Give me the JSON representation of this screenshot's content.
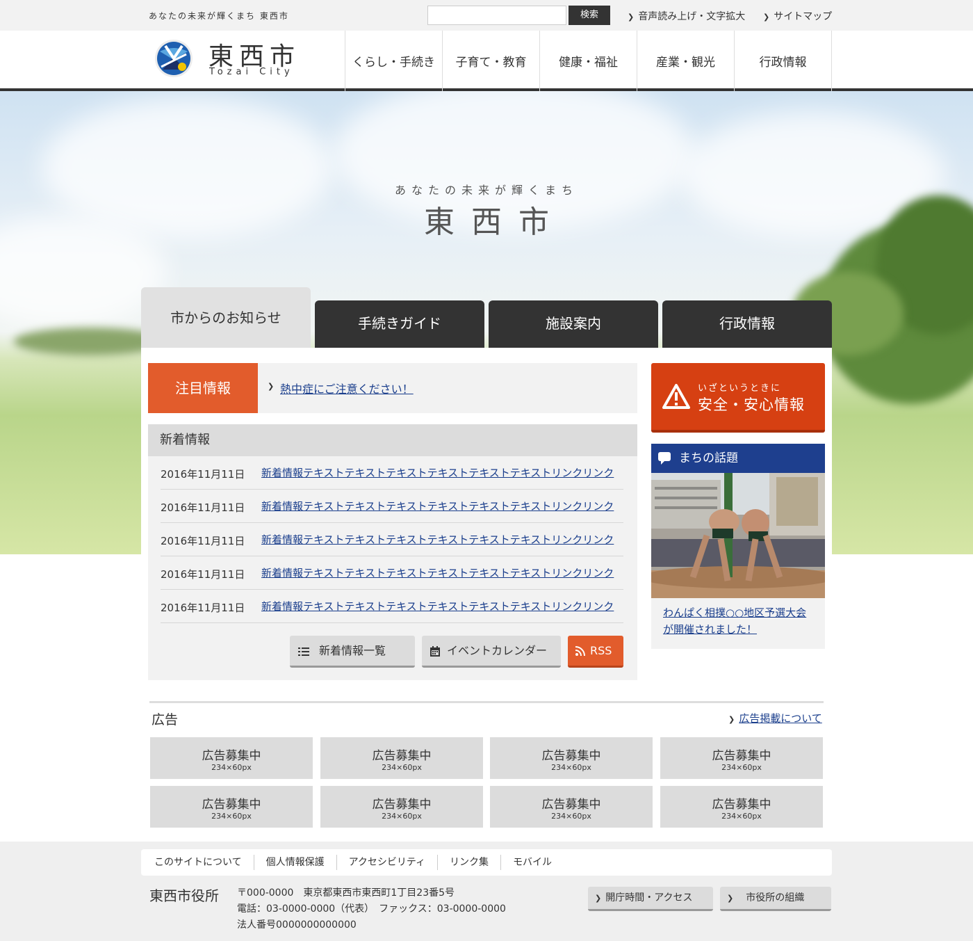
{
  "topbar": {
    "tagline": "あなたの未来が輝くまち 東西市",
    "search_placeholder": "",
    "search_button": "検索",
    "voice_link": "音声読み上げ・文字拡大",
    "sitemap_link": "サイトマップ"
  },
  "header": {
    "title": "東西市",
    "subtitle": "Tozai City",
    "nav": [
      "くらし・手続き",
      "子育て・教育",
      "健康・福祉",
      "産業・観光",
      "行政情報"
    ]
  },
  "hero": {
    "tagline": "あなたの未来が輝くまち",
    "title": "東西市"
  },
  "tabs": [
    "市からのお知らせ",
    "手続きガイド",
    "施設案内",
    "行政情報"
  ],
  "notice": {
    "label": "注目情報",
    "link": "熱中症にご注意ください！"
  },
  "news": {
    "heading": "新着情報",
    "items": [
      {
        "date": "2016年11月11日",
        "text": "新着情報テキストテキストテキストテキストテキストテキストリンクリンク"
      },
      {
        "date": "2016年11月11日",
        "text": "新着情報テキストテキストテキストテキストテキストテキストリンクリンク"
      },
      {
        "date": "2016年11月11日",
        "text": "新着情報テキストテキストテキストテキストテキストテキストリンクリンク"
      },
      {
        "date": "2016年11月11日",
        "text": "新着情報テキストテキストテキストテキストテキストテキストリンクリンク"
      },
      {
        "date": "2016年11月11日",
        "text": "新着情報テキストテキストテキストテキストテキストテキストリンクリンク"
      }
    ],
    "list_button": "新着情報一覧",
    "calendar_button": "イベントカレンダー",
    "rss_button": "RSS"
  },
  "safety": {
    "small": "いざというときに",
    "big": "安全・安心情報"
  },
  "topics": {
    "heading": "まちの話題",
    "link": "わんぱく相撲○○地区予選大会が開催されました！"
  },
  "ads": {
    "title": "広告",
    "about_link": "広告掲載について",
    "items": [
      {
        "label": "広告募集中",
        "size": "234×60px"
      },
      {
        "label": "広告募集中",
        "size": "234×60px"
      },
      {
        "label": "広告募集中",
        "size": "234×60px"
      },
      {
        "label": "広告募集中",
        "size": "234×60px"
      },
      {
        "label": "広告募集中",
        "size": "234×60px"
      },
      {
        "label": "広告募集中",
        "size": "234×60px"
      },
      {
        "label": "広告募集中",
        "size": "234×60px"
      },
      {
        "label": "広告募集中",
        "size": "234×60px"
      }
    ]
  },
  "footer": {
    "nav": [
      "このサイトについて",
      "個人情報保護",
      "アクセシビリティ",
      "リンク集",
      "モバイル"
    ],
    "office_name": "東西市役所",
    "address": "〒000-0000　東京都東西市東西町1丁目23番5号",
    "phone": "電話：03-0000-0000（代表）　ファックス：03-0000-0000",
    "corp_number": "法人番号0000000000000",
    "access_button": "開庁時間・アクセス",
    "org_button": "市役所の組織"
  },
  "colors": {
    "accent_orange": "#e25c2c",
    "safety_red": "#d64012",
    "topics_blue": "#1e3f8e",
    "dark": "#333333",
    "link": "#1a3e8c"
  },
  "icons": [
    "chevron-right-icon",
    "city-logo-icon",
    "list-icon",
    "calendar-icon",
    "rss-icon",
    "warning-icon",
    "speech-bubble-icon"
  ]
}
